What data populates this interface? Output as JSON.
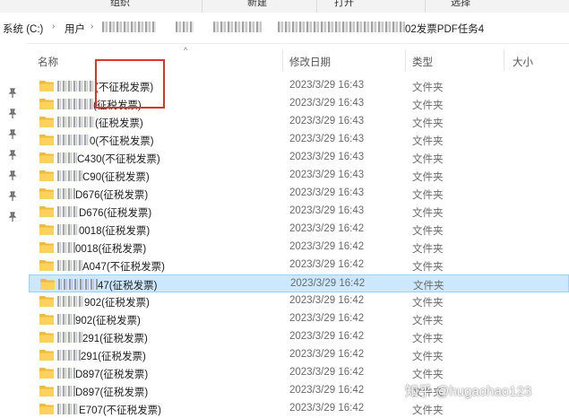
{
  "ribbon": {
    "items": [
      "组织",
      "新建",
      "打开",
      "选择"
    ]
  },
  "breadcrumb": {
    "drive": "系统 (C:)",
    "users": "用户",
    "tail": "02发票PDF任务4"
  },
  "columns": {
    "name": "名称",
    "modified": "修改日期",
    "type": "类型",
    "size": "大小"
  },
  "rows": [
    {
      "name": "(不征税发票)",
      "date": "2023/3/29 16:43",
      "type": "文件夹"
    },
    {
      "name": "(征税发票)",
      "date": "2023/3/29 16:43",
      "type": "文件夹"
    },
    {
      "name": "(征税发票)",
      "date": "2023/3/29 16:43",
      "type": "文件夹"
    },
    {
      "name": "0(不征税发票)",
      "date": "2023/3/29 16:43",
      "type": "文件夹"
    },
    {
      "name": "C430(不征税发票)",
      "date": "2023/3/29 16:43",
      "type": "文件夹"
    },
    {
      "name": "C90(征税发票)",
      "date": "2023/3/29 16:43",
      "type": "文件夹"
    },
    {
      "name": "D676(征税发票)",
      "date": "2023/3/29 16:43",
      "type": "文件夹"
    },
    {
      "name": "D676(征税发票)",
      "date": "2023/3/29 16:43",
      "type": "文件夹"
    },
    {
      "name": "0018(征税发票)",
      "date": "2023/3/29 16:42",
      "type": "文件夹"
    },
    {
      "name": "0018(征税发票)",
      "date": "2023/3/29 16:42",
      "type": "文件夹"
    },
    {
      "name": "A047(不征税发票)",
      "date": "2023/3/29 16:42",
      "type": "文件夹"
    },
    {
      "name": "47(征税发票)",
      "date": "2023/3/29 16:42",
      "type": "文件夹"
    },
    {
      "name": "902(征税发票)",
      "date": "2023/3/29 16:42",
      "type": "文件夹"
    },
    {
      "name": "902(征税发票)",
      "date": "2023/3/29 16:42",
      "type": "文件夹"
    },
    {
      "name": "291(征税发票)",
      "date": "2023/3/29 16:42",
      "type": "文件夹"
    },
    {
      "name": "291(征税发票)",
      "date": "2023/3/29 16:42",
      "type": "文件夹"
    },
    {
      "name": "D897(征税发票)",
      "date": "2023/3/29 16:42",
      "type": "文件夹"
    },
    {
      "name": "D897(征税发票)",
      "date": "2023/3/29 16:42",
      "type": "文件夹"
    },
    {
      "name": "E707(不征税发票)",
      "date": "2023/3/29 16:42",
      "type": "文件夹"
    }
  ],
  "selected_row": 11,
  "watermark": "知乎 @hugaohao123",
  "colors": {
    "selection": "#cce8ff",
    "annotation": "#d9352b",
    "folder": "#f5c242"
  },
  "icons": {
    "folder": "folder-icon",
    "pin": "pin-icon",
    "chevron": "chevron-right-icon",
    "sort": "sort-up-icon"
  }
}
